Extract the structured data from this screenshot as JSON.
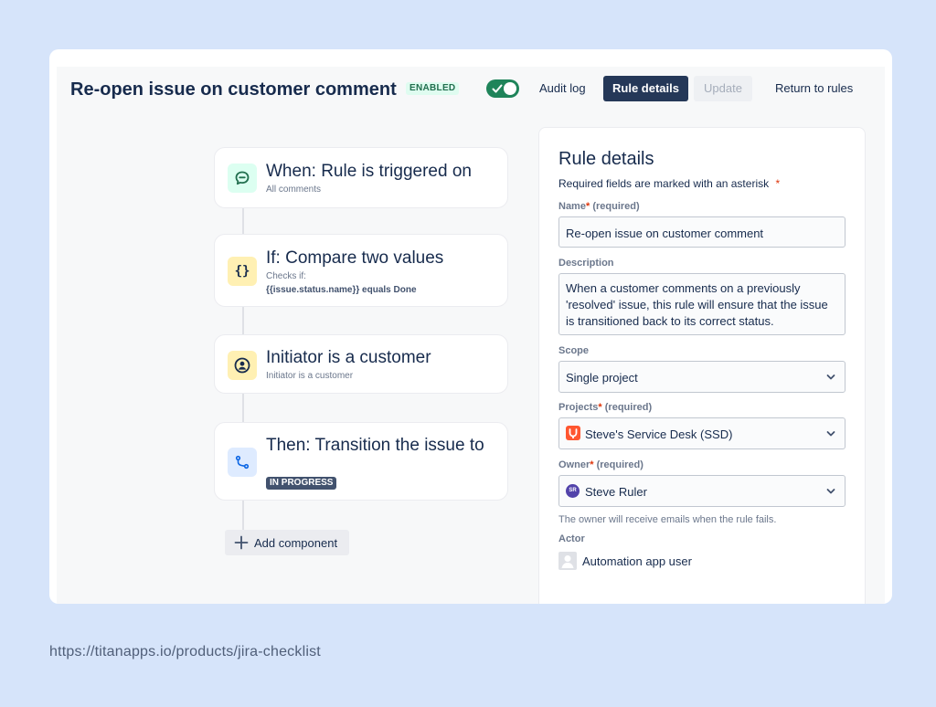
{
  "header": {
    "title": "Re-open issue on customer comment",
    "badge": "ENABLED",
    "audit_log": "Audit log",
    "rule_details": "Rule details",
    "update": "Update",
    "return_to_rules": "Return to rules"
  },
  "flow": {
    "nodes": [
      {
        "title": "When: Rule is triggered on",
        "sub": "All comments",
        "icon": "comment-icon"
      },
      {
        "title": "If: Compare two values",
        "sub": "Checks if:",
        "detail": "{{issue.status.name}} equals Done",
        "icon": "braces-icon"
      },
      {
        "title": "Initiator is a customer",
        "sub": "Initiator is a customer",
        "icon": "customer-icon"
      },
      {
        "title": "Then: Transition the issue to",
        "status": "IN PROGRESS",
        "icon": "transition-icon"
      }
    ],
    "add_component": "Add component"
  },
  "panel": {
    "title": "Rule details",
    "required_note": "Required fields are marked with an asterisk",
    "asterisk": "*",
    "required_text": "(required)",
    "name": {
      "label": "Name",
      "value": "Re-open issue on customer comment"
    },
    "description": {
      "label": "Description",
      "value": "When a customer comments on a previously 'resolved' issue, this rule will ensure that the issue is transitioned back to its correct status."
    },
    "scope": {
      "label": "Scope",
      "value": "Single project"
    },
    "projects": {
      "label": "Projects",
      "value": "Steve's Service Desk (SSD)"
    },
    "owner": {
      "label": "Owner",
      "value": "Steve Ruler",
      "initials": "SR"
    },
    "owner_helper": "The owner will receive emails when the rule fails.",
    "actor": {
      "label": "Actor",
      "value": "Automation app user"
    }
  },
  "footer": {
    "url": "https://titanapps.io/products/jira-checklist"
  },
  "colors": {
    "accent": "#253858",
    "enabled": "#1f845a",
    "background": "#d6e4fa"
  }
}
